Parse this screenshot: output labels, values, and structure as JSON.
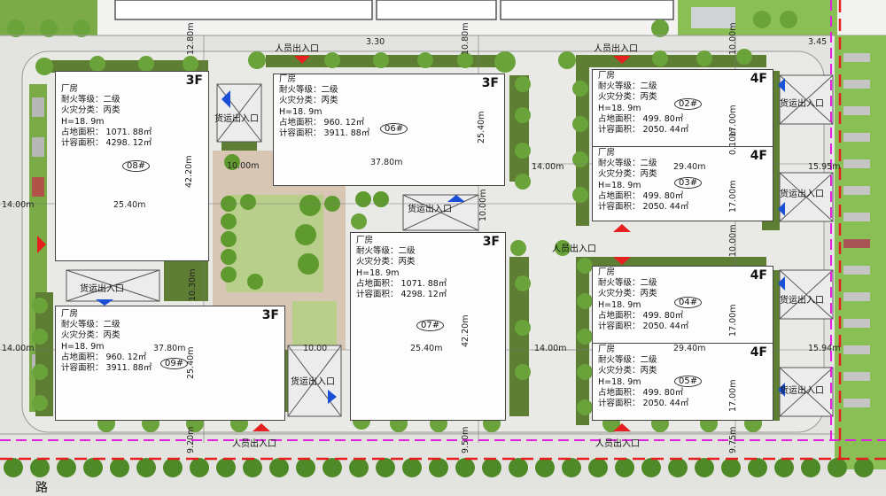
{
  "colors": {
    "road": "#e9e9e6",
    "plaza": "#cfcfcf",
    "paving": "#d9c7b4",
    "green": "#7fb24a",
    "hedge": "#5e7e33",
    "tree": "#5f9a2e",
    "boundary_red": "#e62020",
    "boundary_magenta": "#e020e0",
    "entry_red": "#e62020",
    "entry_blue": "#1a4fd6"
  },
  "buildings": [
    {
      "id": "b08",
      "floors": "3F",
      "number": "08#",
      "type": "厂房",
      "fire_rating": "耐火等级：二级",
      "fire_class": "火灾分类：丙类",
      "height": "H=18. 9m",
      "land_area": "占地面积： 1071. 88㎡",
      "plot_area": "计容面积： 4298. 12㎡"
    },
    {
      "id": "b06",
      "floors": "3F",
      "number": "06#",
      "type": "厂房",
      "fire_rating": "耐火等级：二级",
      "fire_class": "火灾分类：丙类",
      "height": "H=18. 9m",
      "land_area": "占地面积： 960. 12㎡",
      "plot_area": "计容面积： 3911. 88㎡"
    },
    {
      "id": "b02",
      "floors": "4F",
      "number": "02#",
      "type": "厂房",
      "fire_rating": "耐火等级：二级",
      "fire_class": "火灾分类：丙类",
      "height": "H=18. 9m",
      "land_area": "占地面积： 499. 80㎡",
      "plot_area": "计容面积： 2050. 44㎡"
    },
    {
      "id": "b03",
      "floors": "4F",
      "number": "03#",
      "type": "厂房",
      "fire_rating": "耐火等级：二级",
      "fire_class": "火灾分类：丙类",
      "height": "H=18. 9m",
      "land_area": "占地面积： 499. 80㎡",
      "plot_area": "计容面积： 2050. 44㎡"
    },
    {
      "id": "b07",
      "floors": "3F",
      "number": "07#",
      "type": "厂房",
      "fire_rating": "耐火等级：二级",
      "fire_class": "火灾分类：丙类",
      "height": "H=18. 9m",
      "land_area": "占地面积： 1071. 88㎡",
      "plot_area": "计容面积： 4298. 12㎡"
    },
    {
      "id": "b04",
      "floors": "4F",
      "number": "04#",
      "type": "厂房",
      "fire_rating": "耐火等级：二级",
      "fire_class": "火灾分类：丙类",
      "height": "H=18. 9m",
      "land_area": "占地面积： 499. 80㎡",
      "plot_area": "计容面积： 2050. 44㎡"
    },
    {
      "id": "b09",
      "floors": "3F",
      "number": "09#",
      "type": "厂房",
      "fire_rating": "耐火等级：二级",
      "fire_class": "火灾分类：丙类",
      "height": "H=18. 9m",
      "land_area": "占地面积： 960. 12㎡",
      "plot_area": "计容面积： 3911. 88㎡"
    },
    {
      "id": "b05",
      "floors": "4F",
      "number": "05#",
      "type": "厂房",
      "fire_rating": "耐火等级：二级",
      "fire_class": "火灾分类：丙类",
      "height": "H=18. 9m",
      "land_area": "占地面积： 499. 80㎡",
      "plot_area": "计容面积： 2050. 44㎡"
    }
  ],
  "labels": {
    "person_entrance": "人员出入口",
    "cargo_entrance": "货运出入口"
  },
  "dimensions": {
    "d_3_30": "3.30",
    "d_3_45": "3.45",
    "d_10_80m": "10.80m",
    "d_12_80m": "12.80m",
    "d_10_00m": "10.00m",
    "d_37_80m": "37.80m",
    "d_25_40m": "25.40m",
    "d_42_20m": "42.20m",
    "d_14_00m": "14.00m",
    "d_29_40m": "29.40m",
    "d_17_00m": "17.00m",
    "d_0_10m": "0.10m",
    "d_15_95m": "15.95m",
    "d_15_94m": "15.94m",
    "d_9_20m": "9.20m",
    "d_9_50m": "9.50m",
    "d_9_75m": "9.75m",
    "d_10_30m": "10.30m",
    "d_10_00": "10.00"
  },
  "bottom_text": "路"
}
